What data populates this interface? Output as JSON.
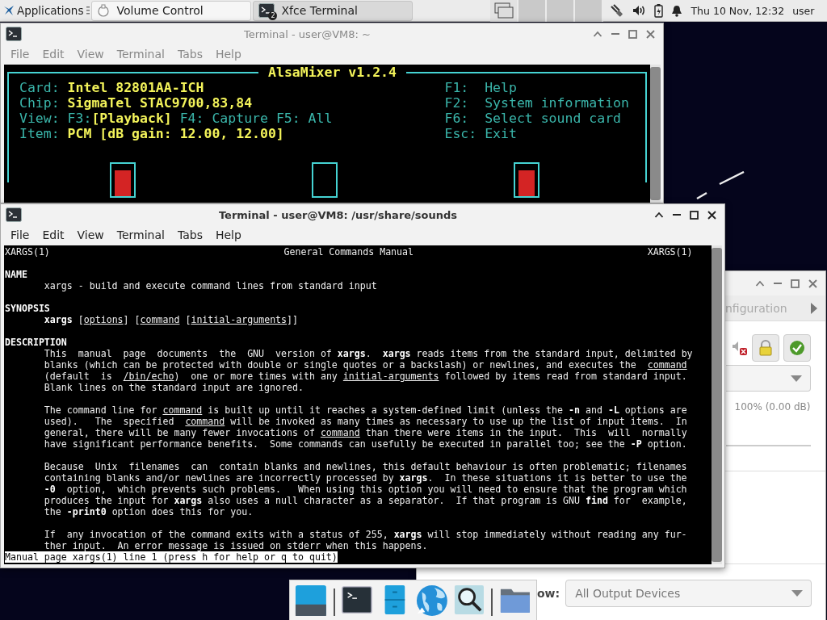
{
  "panel": {
    "apps_menu": "Applications",
    "tasks": [
      {
        "label": "Volume Control",
        "kind": "mixer",
        "selected": false
      },
      {
        "label": "Xfce Terminal",
        "kind": "terminal",
        "badge": "2",
        "selected": true
      }
    ],
    "workspaces": [
      {
        "selected": true
      },
      {
        "selected": false
      },
      {
        "selected": false
      },
      {
        "selected": false
      }
    ],
    "clock": "Thu 10 Nov, 12:32",
    "user": "user"
  },
  "mixer_terminal": {
    "title": "Terminal - user@VM8: ~",
    "active": false,
    "menu": [
      "File",
      "Edit",
      "View",
      "Terminal",
      "Tabs",
      "Help"
    ],
    "alsamixer": {
      "title": "AlsaMixer v1.2.4",
      "info": [
        {
          "kind": "value",
          "label": "Card:",
          "value": "Intel 82801AA-ICH"
        },
        {
          "kind": "value",
          "label": "Chip:",
          "value": "SigmaTel STAC9700,83,84"
        },
        {
          "kind": "views",
          "label": "View:",
          "views": [
            {
              "key": "F3:",
              "name": "[Playback]",
              "selected": true
            },
            {
              "key": "F4:",
              "name": "Capture",
              "selected": false
            },
            {
              "key": "F5:",
              "name": "All",
              "selected": false
            }
          ]
        },
        {
          "kind": "value",
          "label": "Item:",
          "value": "PCM [dB gain: 12.00, 12.00]"
        }
      ],
      "keys": [
        {
          "key": "F1:",
          "action": "Help"
        },
        {
          "key": "F2:",
          "action": "System information"
        },
        {
          "key": "F6:",
          "action": "Select sound card"
        },
        {
          "key": "Esc:",
          "action": "Exit"
        }
      ],
      "faders": [
        {
          "filled": true
        },
        {
          "filled": false
        },
        {
          "filled": true
        }
      ]
    }
  },
  "man_terminal": {
    "title": "Terminal - user@VM8: /usr/share/sounds",
    "active": true,
    "menu": [
      "File",
      "Edit",
      "View",
      "Terminal",
      "Tabs",
      "Help"
    ],
    "header": {
      "left": "XARGS(1)",
      "center": "General Commands Manual",
      "right": "XARGS(1)"
    },
    "sections": [
      {
        "heading": "NAME",
        "paragraphs": [
          [
            "xargs - build and execute command lines from standard input"
          ]
        ]
      },
      {
        "heading": "SYNOPSIS",
        "paragraphs": [
          [
            "**xargs** [*options*] [*command* [*initial-arguments*]]"
          ]
        ]
      },
      {
        "heading": "DESCRIPTION",
        "paragraphs": [
          [
            "This  manual  page  documents  the  GNU  version of **xargs**.  **xargs** reads items from the standard input, delimited by",
            "blanks (which can be protected with double or single quotes or a backslash) or newlines, and executes the  *command*",
            "(default  is  */bin/echo*)  one or more times with any *initial-arguments* followed by items read from standard input.",
            "Blank lines on the standard input are ignored."
          ],
          [
            "The command line for *command* is built up until it reaches a system-defined limit (unless the **-n** and **-L** options are",
            "used).   The  specified  *command* will be invoked as many times as necessary to use up the list of input items.  In",
            "general, there will be many fewer invocations of *command* than there were items in the input.  This  will  normally",
            "have significant performance benefits.  Some commands can usefully be executed in parallel too; see the **-P** option."
          ],
          [
            "Because  Unix  filenames  can  contain blanks and newlines, this default behaviour is often problematic; filenames",
            "containing blanks and/or newlines are incorrectly processed by **xargs**.  In these situations it is better to use the",
            "**-0**  option,  which prevents such problems.   When using this option you will need to ensure that the program which",
            "produces the input for **xargs** also uses a null character as a separator.  If that program is GNU **find** for  example,",
            "the **-print0** option does this for you."
          ],
          [
            "If  any invocation of the command exits with a status of 255, **xargs** will stop immediately without reading any fur-",
            "ther input.  An error message is issued on stderr when this happens."
          ]
        ]
      }
    ],
    "status": "Manual page xargs(1) line 1 (press h for help or q to quit)"
  },
  "volume_control": {
    "tab": "nfiguration",
    "level_text": "100% (0.00 dB)",
    "show_label": "ow:",
    "output_filter": "All Output Devices"
  }
}
